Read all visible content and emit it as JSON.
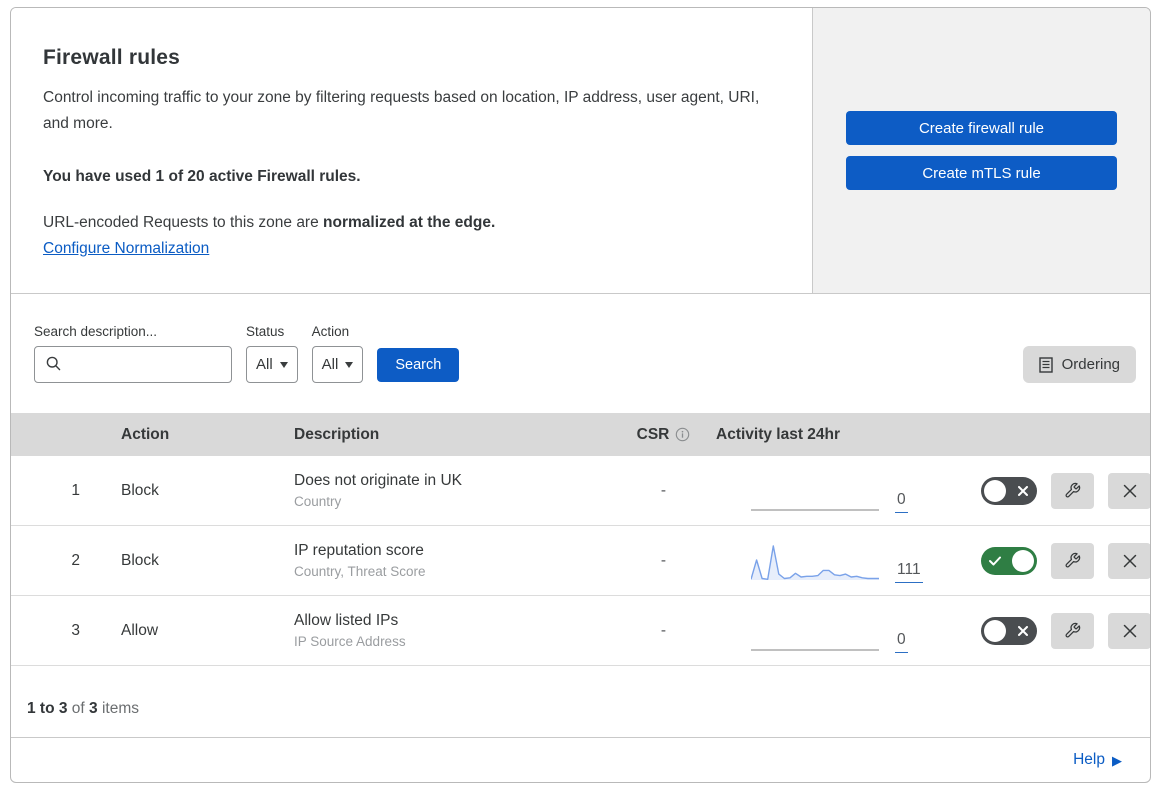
{
  "header": {
    "title": "Firewall rules",
    "description": "Control incoming traffic to your zone by filtering requests based on location, IP address, user agent, URI, and more.",
    "usage_bold": "You have used 1 of 20 active Firewall rules.",
    "normalization_text": "URL-encoded Requests to this zone are ",
    "normalization_bold": "normalized at the edge.",
    "configure_link": "Configure Normalization"
  },
  "actions_panel": {
    "create_firewall_label": "Create firewall rule",
    "create_mtls_label": "Create mTLS rule"
  },
  "filters": {
    "search_label": "Search description...",
    "search_value": "",
    "status_label": "Status",
    "status_value": "All",
    "action_label": "Action",
    "action_value": "All",
    "search_button": "Search",
    "ordering_button": "Ordering"
  },
  "table": {
    "headers": {
      "action": "Action",
      "description": "Description",
      "csr": "CSR",
      "activity": "Activity last 24hr"
    },
    "rows": [
      {
        "num": "1",
        "action": "Block",
        "description": "Does not originate in UK",
        "criteria": "Country",
        "csr": "-",
        "activity_count": "0",
        "enabled": false,
        "activity_series": [
          0,
          0,
          0,
          0,
          0,
          0,
          0,
          0,
          0,
          0,
          0,
          0,
          0,
          0,
          0,
          0,
          0,
          0,
          0,
          0,
          0,
          0,
          0,
          0
        ]
      },
      {
        "num": "2",
        "action": "Block",
        "description": "IP reputation score",
        "criteria": "Country, Threat Score",
        "csr": "-",
        "activity_count": "111",
        "enabled": true,
        "activity_series": [
          1,
          27,
          2,
          1,
          46,
          8,
          2,
          3,
          9,
          4,
          5,
          5,
          6,
          13,
          13,
          7,
          6,
          8,
          4,
          5,
          3,
          2,
          2,
          2
        ]
      },
      {
        "num": "3",
        "action": "Allow",
        "description": "Allow listed IPs",
        "criteria": "IP Source Address",
        "csr": "-",
        "activity_count": "0",
        "enabled": false,
        "activity_series": [
          0,
          0,
          0,
          0,
          0,
          0,
          0,
          0,
          0,
          0,
          0,
          0,
          0,
          0,
          0,
          0,
          0,
          0,
          0,
          0,
          0,
          0,
          0,
          0
        ]
      }
    ]
  },
  "footer": {
    "range_bold": "1 to 3",
    "of_text": " of ",
    "total_bold": "3",
    "items_text": " items",
    "help_label": "Help"
  },
  "colors": {
    "primary_blue": "#0d5cc5",
    "link_blue": "#0b5cc4",
    "toggle_on_green": "#2f7e44",
    "toggle_off_gray": "#4a4d50",
    "sparkline_blue": "#7aa2e9",
    "table_header_gray": "#d9d9d9",
    "side_panel_gray": "#f1f1f1"
  }
}
